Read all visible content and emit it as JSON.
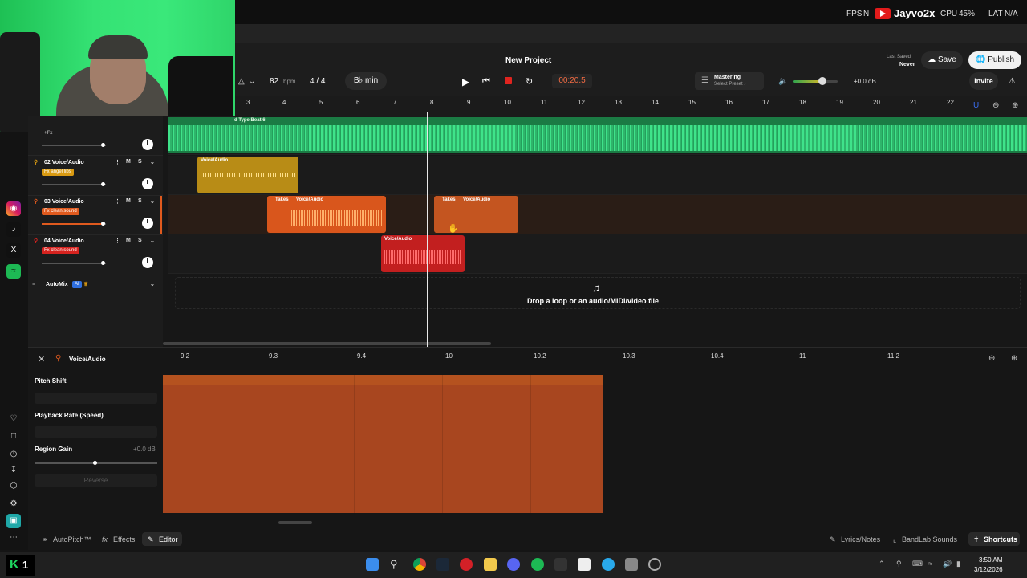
{
  "os": {
    "fps_label": "FPS",
    "n_label": "N",
    "channel": "Jayvo2x",
    "cpu": "CPU",
    "cpu_val": "45%",
    "lat": "LAT",
    "na": "N/A",
    "time": "3:50 AM",
    "date": "3/12/2026"
  },
  "header": {
    "project_title": "New Project",
    "bpm_value": "82",
    "bpm_unit": "bpm",
    "time_signature": "4 / 4",
    "key": "B♭ min",
    "time_display": "00:20.5",
    "mastering_label": "Mastering",
    "mastering_sub": "Select Preset ›",
    "volume_db": "+0.0 dB",
    "last_saved_label": "Last Saved",
    "last_saved_value": "Never",
    "save_label": "Save",
    "publish_label": "Publish",
    "invite_label": "Invite"
  },
  "ruler": {
    "ticks": [
      "3",
      "4",
      "5",
      "6",
      "7",
      "8",
      "9",
      "10",
      "11",
      "12",
      "13",
      "14",
      "15",
      "16",
      "17",
      "18",
      "19",
      "20",
      "21",
      "22"
    ]
  },
  "tracks": [
    {
      "name": "Type Beat",
      "fx": "+Fx"
    },
    {
      "name": "02 Voice/Audio",
      "fx": "Fx angel libs",
      "fx_color": "#d99a12"
    },
    {
      "name": "03 Voice/Audio",
      "fx": "Fx clean sound",
      "fx_color": "#e05a1e"
    },
    {
      "name": "04 Voice/Audio",
      "fx": "Fx clean sound",
      "fx_color": "#d6231f"
    }
  ],
  "regions": {
    "beat_label": "d Type Beat 6",
    "r2_label": "Voice/Audio",
    "r3a_takes": "Takes",
    "r3a_label": "Voice/Audio",
    "r3b_takes": "Takes",
    "r3b_label": "Voice/Audio",
    "r4_label": "Voice/Audio"
  },
  "automix": {
    "label": "AutoMix",
    "ai": "AI"
  },
  "drop": {
    "text": "Drop a loop or an audio/MIDI/video file"
  },
  "editor": {
    "title": "Voice/Audio",
    "pitch_label": "Pitch Shift",
    "rate_label": "Playback Rate (Speed)",
    "gain_label": "Region Gain",
    "gain_value": "+0.0 dB",
    "reverse_label": "Reverse",
    "ticks": [
      "9.2",
      "9.3",
      "9.4",
      "10",
      "10.2",
      "10.3",
      "10.4",
      "11",
      "11.2"
    ]
  },
  "bottom": {
    "autopitch": "AutoPitch™",
    "effects": "Effects",
    "editor": "Editor",
    "lyrics": "Lyrics/Notes",
    "bandlab": "BandLab Sounds",
    "shortcuts": "Shortcuts"
  }
}
